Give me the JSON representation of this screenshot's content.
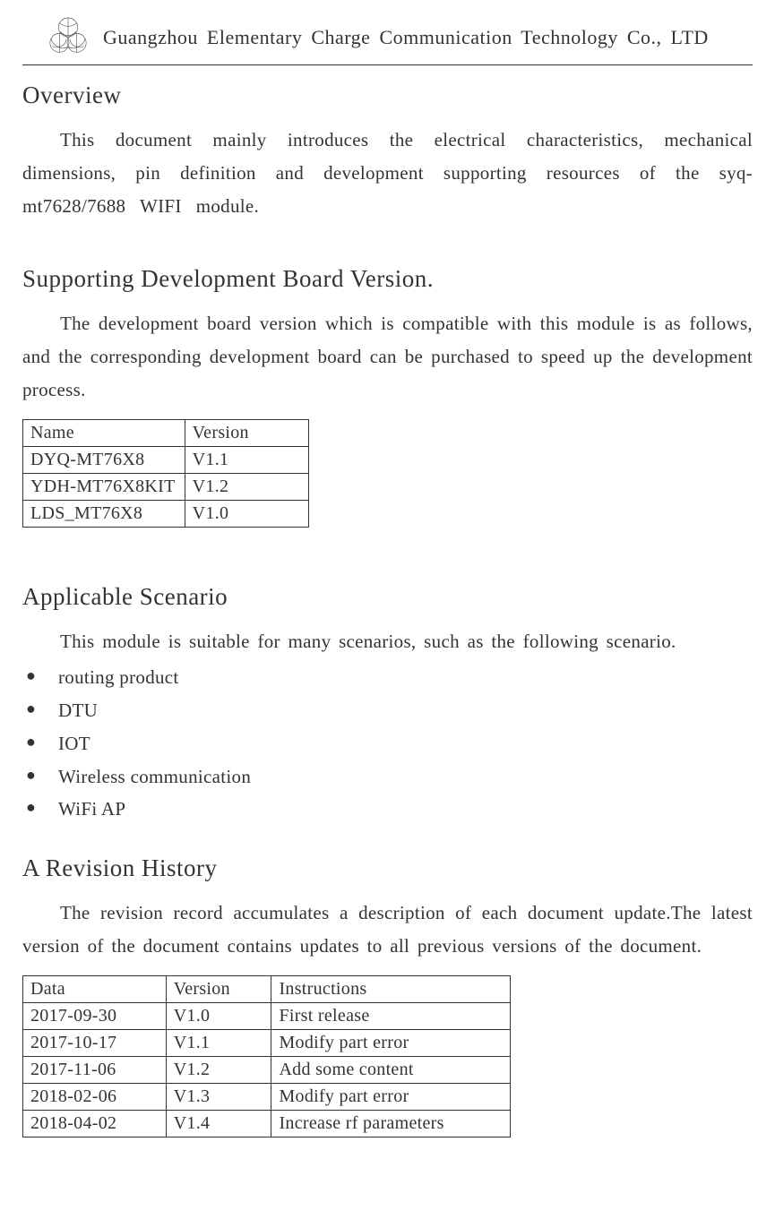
{
  "header": {
    "company": "Guangzhou Elementary Charge Communication Technology Co., LTD"
  },
  "overview": {
    "heading": "Overview",
    "text": "This document mainly introduces the electrical characteristics, mechanical dimensions, pin definition and development supporting resources of the syq-mt7628/7688 WIFI module."
  },
  "devboard": {
    "heading": "Supporting Development Board Version.",
    "text": "The development board version which is compatible with this module is as follows, and the corresponding development board can be purchased to speed up the development process.",
    "columns": [
      "Name",
      "Version"
    ],
    "rows": [
      {
        "name": "DYQ-MT76X8",
        "version": "V1.1"
      },
      {
        "name": "YDH-MT76X8KIT",
        "version": "V1.2"
      },
      {
        "name": "LDS_MT76X8",
        "version": "V1.0"
      }
    ]
  },
  "scenario": {
    "heading": "Applicable Scenario",
    "text": "This module is suitable for many scenarios, such as the following scenario.",
    "items": [
      "routing product",
      "DTU",
      "IOT",
      "Wireless communication",
      "WiFi AP"
    ]
  },
  "revision": {
    "heading": "A Revision History",
    "text": "The revision record accumulates a description of each document update.The latest version of the document contains updates to all previous versions of the document.",
    "columns": [
      "Data",
      "Version",
      "Instructions"
    ],
    "rows": [
      {
        "date": "2017-09-30",
        "version": "V1.0",
        "instructions": "First release"
      },
      {
        "date": "2017-10-17",
        "version": "V1.1",
        "instructions": "Modify part error"
      },
      {
        "date": "2017-11-06",
        "version": "V1.2",
        "instructions": "Add some content"
      },
      {
        "date": "2018-02-06",
        "version": "V1.3",
        "instructions": "Modify part error"
      },
      {
        "date": "2018-04-02",
        "version": "V1.4",
        "instructions": "Increase rf parameters"
      }
    ]
  }
}
